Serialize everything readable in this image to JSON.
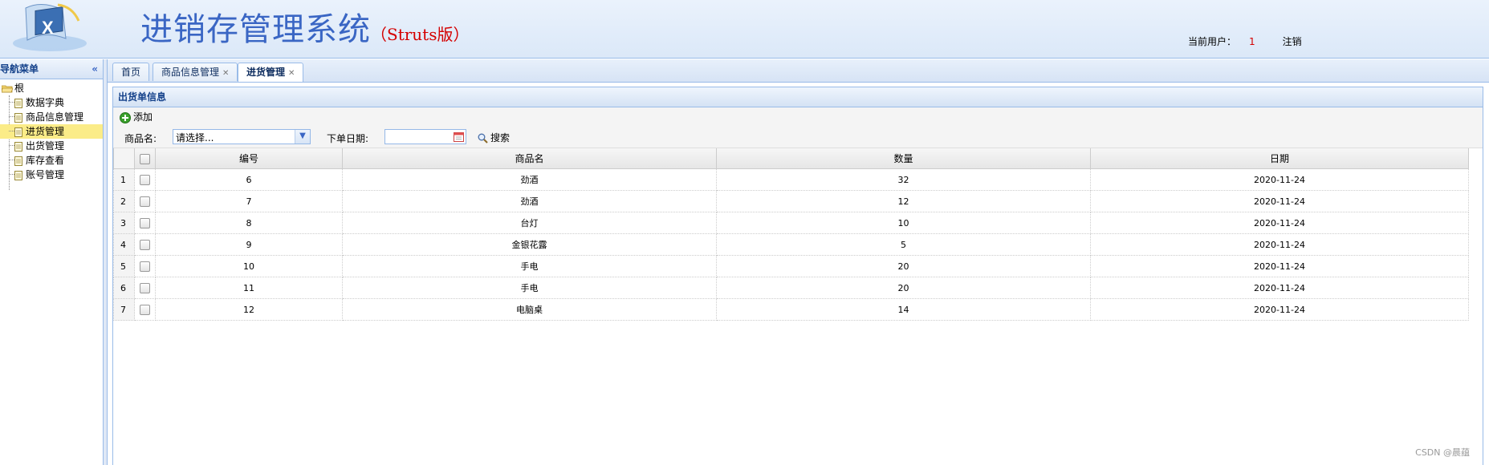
{
  "header": {
    "title": "进销存管理系统",
    "subtitle": "（Struts版）",
    "current_user_label": "当前用户：",
    "current_user": "1",
    "logout_label": "注销"
  },
  "nav": {
    "title": "导航菜单",
    "collapse_icon": "«",
    "root": "根",
    "items": [
      {
        "label": "数据字典"
      },
      {
        "label": "商品信息管理"
      },
      {
        "label": "进货管理",
        "selected": true
      },
      {
        "label": "出货管理"
      },
      {
        "label": "库存查看"
      },
      {
        "label": "账号管理"
      }
    ]
  },
  "tabs": [
    {
      "label": "首页"
    },
    {
      "label": "商品信息管理",
      "closable": true
    },
    {
      "label": "进货管理",
      "closable": true,
      "active": true
    }
  ],
  "panel": {
    "title": "出货单信息",
    "add_label": "添加",
    "product_label": "商品名:",
    "product_select_value": "请选择...",
    "date_label": "下单日期:",
    "date_value": "",
    "search_label": "搜索"
  },
  "grid": {
    "columns": [
      "编号",
      "商品名",
      "数量",
      "日期"
    ],
    "rows": [
      {
        "rownum": "1",
        "id": "6",
        "name": "劲酒",
        "qty": "32",
        "date": "2020-11-24"
      },
      {
        "rownum": "2",
        "id": "7",
        "name": "劲酒",
        "qty": "12",
        "date": "2020-11-24"
      },
      {
        "rownum": "3",
        "id": "8",
        "name": "台灯",
        "qty": "10",
        "date": "2020-11-24"
      },
      {
        "rownum": "4",
        "id": "9",
        "name": "金银花露",
        "qty": "5",
        "date": "2020-11-24"
      },
      {
        "rownum": "5",
        "id": "10",
        "name": "手电",
        "qty": "20",
        "date": "2020-11-24"
      },
      {
        "rownum": "6",
        "id": "11",
        "name": "手电",
        "qty": "20",
        "date": "2020-11-24"
      },
      {
        "rownum": "7",
        "id": "12",
        "name": "电脑桌",
        "qty": "14",
        "date": "2020-11-24"
      }
    ]
  },
  "watermark": "CSDN @晨蕴",
  "colors": {
    "title_blue": "#3a66c4",
    "accent_red": "#d40000",
    "border_blue": "#99bbe8",
    "selected_yellow": "#fbec88"
  }
}
